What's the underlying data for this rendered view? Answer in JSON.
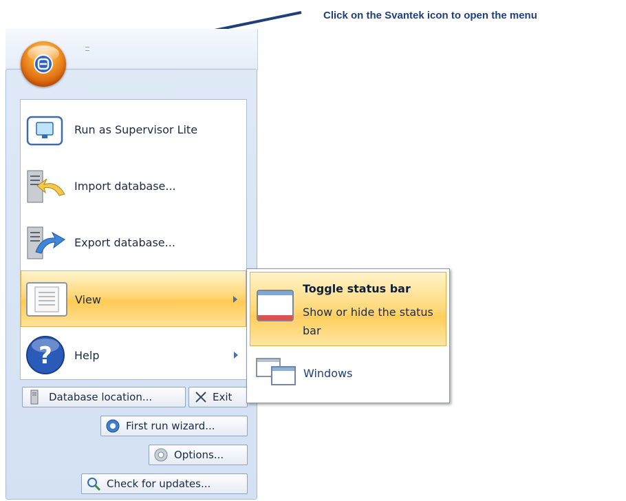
{
  "annotation": {
    "text": "Click on the Svantek icon to open the menu"
  },
  "app_button": {
    "icon": "svantek-logo-icon"
  },
  "menu": {
    "items": [
      {
        "label": "Run as Supervisor Lite",
        "icon": "monitor-icon"
      },
      {
        "label": "Import database...",
        "icon": "import-database-icon"
      },
      {
        "label": "Export database...",
        "icon": "export-database-icon"
      },
      {
        "label": "View",
        "icon": "document-icon"
      },
      {
        "label": "Help",
        "icon": "help-icon"
      }
    ]
  },
  "submenu": {
    "toggle_title": "Toggle status bar",
    "toggle_desc": "Show or hide the status bar",
    "windows_label": "Windows"
  },
  "footer_buttons": {
    "database_location": "Database location...",
    "exit": "Exit",
    "first_run_wizard": "First run wizard...",
    "options": "Options...",
    "check_updates": "Check for updates..."
  },
  "colors": {
    "hover": "#ffd776",
    "orb": "#f49a2a",
    "annotation": "#1f3f7a"
  }
}
